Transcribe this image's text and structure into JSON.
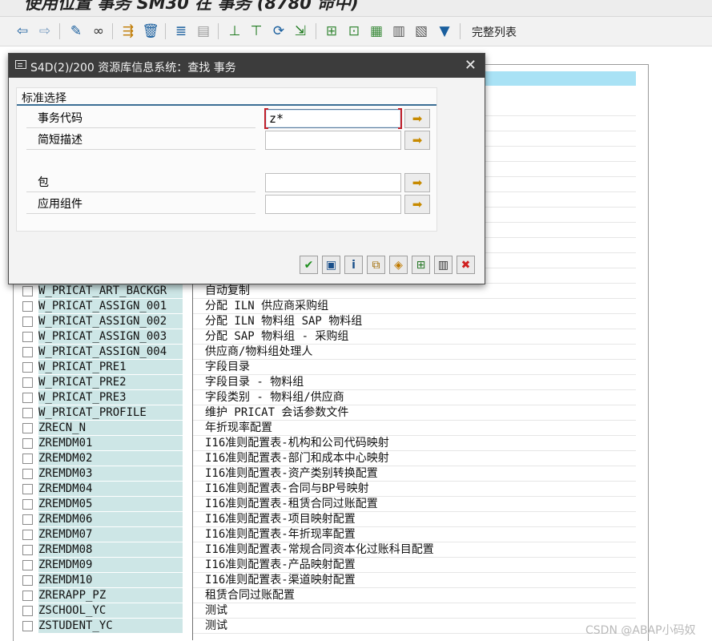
{
  "window": {
    "partial_title": "使用位置 事务 SM30 在 事务 (8780 命中)"
  },
  "toolbar": {
    "full_list_label": "完整列表",
    "icons": [
      "back-icon",
      "forward-icon",
      "edit-icon",
      "glasses-icon",
      "where-used-icon",
      "delete-icon",
      "align-icon",
      "panel-icon",
      "sort-asc-icon",
      "sort-desc-icon",
      "refresh-icon",
      "export-icon",
      "select-all-icon",
      "deselect-icon",
      "doc-icon",
      "doc-edit-icon",
      "doc-delete-icon",
      "filter-icon"
    ]
  },
  "dialog": {
    "title": "S4D(2)/200 资源库信息系统：查找 事务",
    "group_title": "标准选择",
    "fields": [
      {
        "label": "事务代码",
        "value": "z*"
      },
      {
        "label": "简短描述",
        "value": ""
      },
      {
        "label": "包",
        "value": ""
      },
      {
        "label": "应用组件",
        "value": ""
      }
    ],
    "footer_buttons": [
      "check-icon",
      "save-icon",
      "info-icon",
      "copy-icon",
      "options-icon",
      "add-criteria-icon",
      "columns-icon",
      "cancel-icon"
    ]
  },
  "list": {
    "rows": [
      {
        "code": "W_PRICAT_ART_BACKGR",
        "desc": "自动复制"
      },
      {
        "code": "W_PRICAT_ASSIGN_001",
        "desc": "分配 ILN 供应商采购组"
      },
      {
        "code": "W_PRICAT_ASSIGN_002",
        "desc": "分配 ILN 物料组 SAP 物料组"
      },
      {
        "code": "W_PRICAT_ASSIGN_003",
        "desc": "分配 SAP 物料组 - 采购组"
      },
      {
        "code": "W_PRICAT_ASSIGN_004",
        "desc": "供应商/物料组处理人"
      },
      {
        "code": "W_PRICAT_PRE1",
        "desc": "字段目录"
      },
      {
        "code": "W_PRICAT_PRE2",
        "desc": "字段目录 - 物料组"
      },
      {
        "code": "W_PRICAT_PRE3",
        "desc": "字段类别 - 物料组/供应商"
      },
      {
        "code": "W_PRICAT_PROFILE",
        "desc": "维护 PRICAT 会话参数文件"
      },
      {
        "code": "ZRECN_N",
        "desc": "年折现率配置"
      },
      {
        "code": "ZREMDM01",
        "desc": "I16准则配置表-机构和公司代码映射"
      },
      {
        "code": "ZREMDM02",
        "desc": "I16准则配置表-部门和成本中心映射"
      },
      {
        "code": "ZREMDM03",
        "desc": "I16准则配置表-资产类别转换配置"
      },
      {
        "code": "ZREMDM04",
        "desc": "I16准则配置表-合同与BP号映射"
      },
      {
        "code": "ZREMDM05",
        "desc": "I16准则配置表-租赁合同过账配置"
      },
      {
        "code": "ZREMDM06",
        "desc": "I16准则配置表-项目映射配置"
      },
      {
        "code": "ZREMDM07",
        "desc": "I16准则配置表-年折现率配置"
      },
      {
        "code": "ZREMDM08",
        "desc": "I16准则配置表-常规合同资本化过账科目配置"
      },
      {
        "code": "ZREMDM09",
        "desc": "I16准则配置表-产品映射配置"
      },
      {
        "code": "ZREMDM10",
        "desc": "I16准则配置表-渠道映射配置"
      },
      {
        "code": "ZRERAPP_PZ",
        "desc": "租赁合同过账配置"
      },
      {
        "code": "ZSCHOOL_YC",
        "desc": "测试"
      },
      {
        "code": "ZSTUDENT_YC",
        "desc": "测试"
      }
    ]
  },
  "watermark": "CSDN @ABAP小码奴"
}
